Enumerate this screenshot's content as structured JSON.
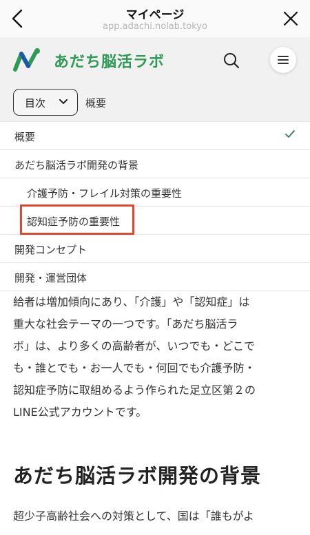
{
  "browser": {
    "title": "マイページ",
    "url": "app.adachi.nolab.tokyo"
  },
  "header": {
    "site_title": "あだち脳活ラボ",
    "brand_color": "#2f9a55"
  },
  "toc": {
    "select_label": "目次",
    "current_section": "概要"
  },
  "dropdown": {
    "items": [
      {
        "label": "概要",
        "selected": true
      },
      {
        "label": "あだち脳活ラボ開発の背景"
      },
      {
        "label": "介護予防・フレイル対策の重要性"
      },
      {
        "label": "認知症予防の重要性"
      },
      {
        "label": "開発コンセプト"
      },
      {
        "label": "開発・運営団体"
      }
    ],
    "highlight_color": "#e8442a"
  },
  "article": {
    "lines": [
      "給者は増加傾向にあり、「介護」や「認知症」は",
      "重大な社会テーマの一つです。「あだち脳活ラ",
      "ボ」は、より多くの高齢者が、いつでも・どこで",
      "も・誰とでも・お一人でも・何回でも介護予防・",
      "認知症予防に取組めるよう作られた足立区第２の",
      "LINE公式アカウントです。"
    ],
    "heading": "あだち脳活ラボ開発の背景",
    "next_line": "超少子高齢社会への対策として、国は「誰もがよ"
  }
}
